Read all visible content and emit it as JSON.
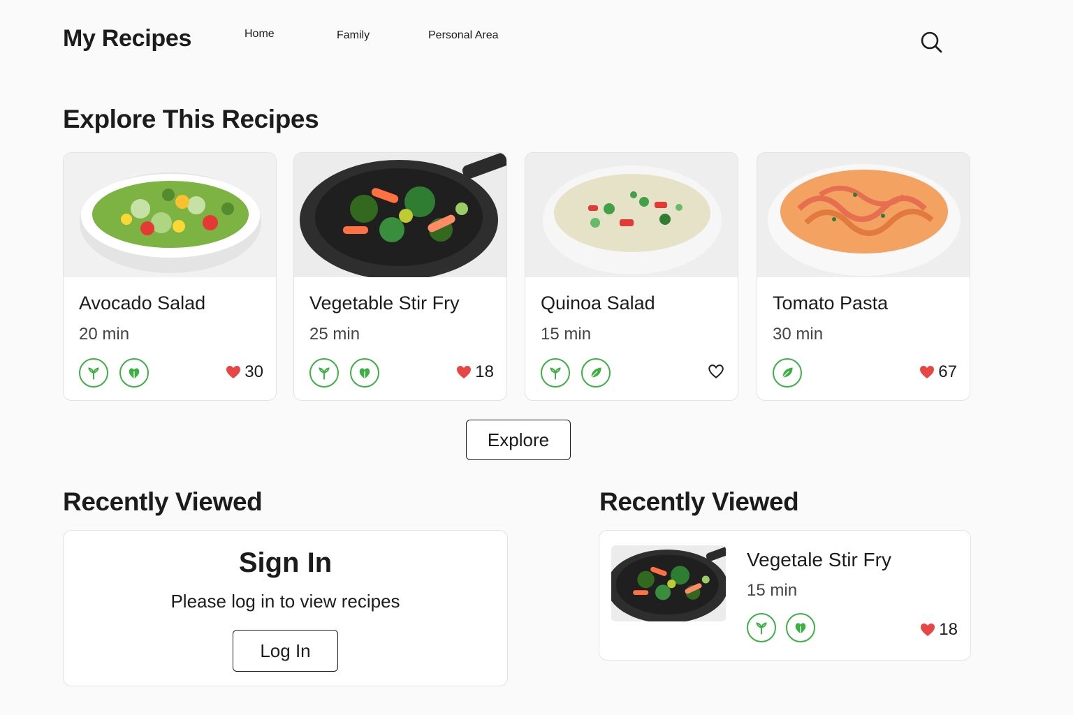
{
  "header": {
    "brand": "My Recipes",
    "nav": [
      "Home",
      "Family",
      "Personal Area"
    ],
    "search_icon": "search-icon"
  },
  "explore": {
    "title": "Explore This Recipes",
    "button_label": "Explore",
    "recipes": [
      {
        "name": "Avocado Salad",
        "time": "20 min",
        "likes": "30",
        "liked": true,
        "icons": [
          "sprout-icon",
          "heart-leaf-icon"
        ],
        "image": "salad-bowl"
      },
      {
        "name": "Vegetable Stir Fry",
        "time": "25 min",
        "likes": "18",
        "liked": true,
        "icons": [
          "sprout-icon",
          "heart-leaf-icon"
        ],
        "image": "stir-fry-pan"
      },
      {
        "name": "Quinoa Salad",
        "time": "15 min",
        "likes": "",
        "liked": false,
        "icons": [
          "sprout-icon",
          "leaf-icon"
        ],
        "image": "quinoa-bowl"
      },
      {
        "name": "Tomato Pasta",
        "time": "30 min",
        "likes": "67",
        "liked": true,
        "icons": [
          "leaf-icon"
        ],
        "image": "pasta-bowl"
      }
    ]
  },
  "recent_left": {
    "title": "Recently Viewed",
    "signin_title": "Sign In",
    "signin_message": "Please log in to view recipes",
    "login_label": "Log In"
  },
  "recent_right": {
    "title": "Recently Viewed",
    "item": {
      "name": "Vegetale Stir Fry",
      "time": "15 min",
      "likes": "18",
      "icons": [
        "sprout-icon",
        "heart-leaf-icon"
      ],
      "image": "stir-fry-pan"
    }
  },
  "colors": {
    "accent_green": "#3cb043",
    "like_red": "#e84545",
    "text": "#1c1c1c"
  }
}
